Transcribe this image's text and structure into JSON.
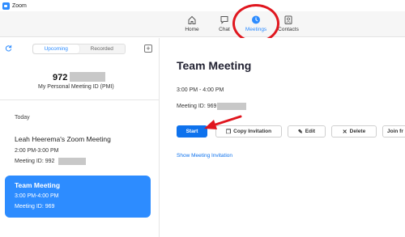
{
  "window": {
    "title": "Zoom"
  },
  "nav": {
    "items": [
      {
        "label": "Home",
        "icon": "home-icon"
      },
      {
        "label": "Chat",
        "icon": "chat-icon"
      },
      {
        "label": "Meetings",
        "icon": "clock-icon",
        "active": true
      },
      {
        "label": "Contacts",
        "icon": "contacts-icon"
      }
    ],
    "accent": "#2d8cff"
  },
  "sidebar": {
    "tabs": {
      "upcoming": "Upcoming",
      "recorded": "Recorded",
      "selected": "Upcoming"
    },
    "pmi": {
      "number": "972",
      "label": "My Personal Meeting ID (PMI)"
    },
    "section": "Today",
    "meetings": [
      {
        "title": "Leah Heerema's Zoom Meeting",
        "time": "2:00 PM-3:00 PM",
        "id": "Meeting ID: 992"
      },
      {
        "title": "Team Meeting",
        "time": "3:00 PM-4:00 PM",
        "id": "Meeting ID: 969",
        "selected": true
      }
    ]
  },
  "detail": {
    "title": "Team Meeting",
    "time": "3:00 PM - 4:00 PM",
    "meeting_id": "Meeting ID: 969",
    "buttons": {
      "start": "Start",
      "copy": "Copy Invitation",
      "edit": "Edit",
      "delete": "Delete",
      "join": "Join fr"
    },
    "show_invitation": "Show Meeting Invitation"
  },
  "colors": {
    "primary_button": "#0e72ed",
    "annotation_red": "#e0161e",
    "selected_card": "#2d8cff"
  }
}
